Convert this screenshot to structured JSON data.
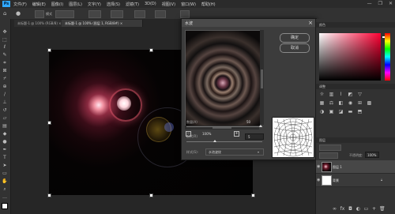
{
  "app": {
    "logo": "Ps",
    "menu": [
      "文件(F)",
      "编辑(E)",
      "图像(I)",
      "图层(L)",
      "文字(Y)",
      "选择(S)",
      "滤镜(T)",
      "3D(D)",
      "视图(V)",
      "窗口(W)",
      "帮助(H)"
    ],
    "window_controls": [
      "—",
      "❐",
      "✕"
    ]
  },
  "options_bar": {
    "mode_label": "模式"
  },
  "doc_tabs": [
    {
      "label": "未标题-1 @ 100% (RGB/8) ×",
      "active": false
    },
    {
      "label": "未标题-1 @ 100% (图层 1, RGB/8#) ×",
      "active": true
    }
  ],
  "dialog": {
    "title": "水波",
    "close_icon": "close-icon",
    "ok_label": "确定",
    "cancel_label": "取消",
    "zoom_value": "100%",
    "params": [
      {
        "label": "数量(A)",
        "value": "50"
      },
      {
        "label": "起伏(R)",
        "value": "5"
      }
    ],
    "style_label": "样式(S):",
    "style_value": "水池波纹"
  },
  "panels": {
    "color_header": "颜色",
    "adjust_header": "调整",
    "layers_header": "图层",
    "opacity_label": "不透明度:",
    "opacity_value": "100%",
    "fill_label": "填充:",
    "fill_value": "100%",
    "layers": [
      {
        "name": "图层 1",
        "selected": true
      },
      {
        "name": "背景",
        "selected": false
      }
    ]
  },
  "colors": {
    "brand": "#31a8ff",
    "ui_bg": "#262626",
    "panel_bg": "#323232",
    "dialog_bg": "#3c3c3c"
  }
}
